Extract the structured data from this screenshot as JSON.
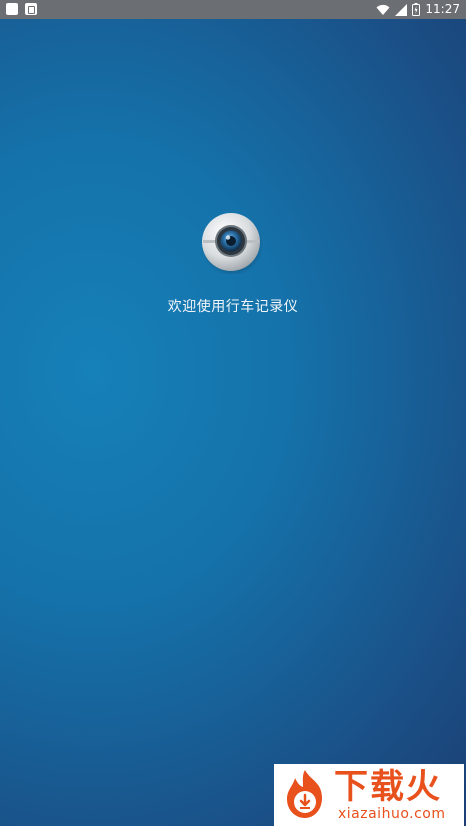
{
  "status_bar": {
    "time": "11:27",
    "notification_icons": [
      "square-icon",
      "photo-icon"
    ],
    "system_icons": [
      "wifi-icon",
      "cell-signal-icon",
      "battery-icon"
    ]
  },
  "splash": {
    "logo_icon": "dashcam-lens-icon",
    "welcome_text": "欢迎使用行车记录仪"
  },
  "watermark": {
    "brand": "下载火",
    "domain": "xiazaihuo.com",
    "color": "#e8501c"
  },
  "colors": {
    "background_top": "#1680b8",
    "background_edge": "#1c3c6e",
    "status_bar": "#6b6f73"
  }
}
